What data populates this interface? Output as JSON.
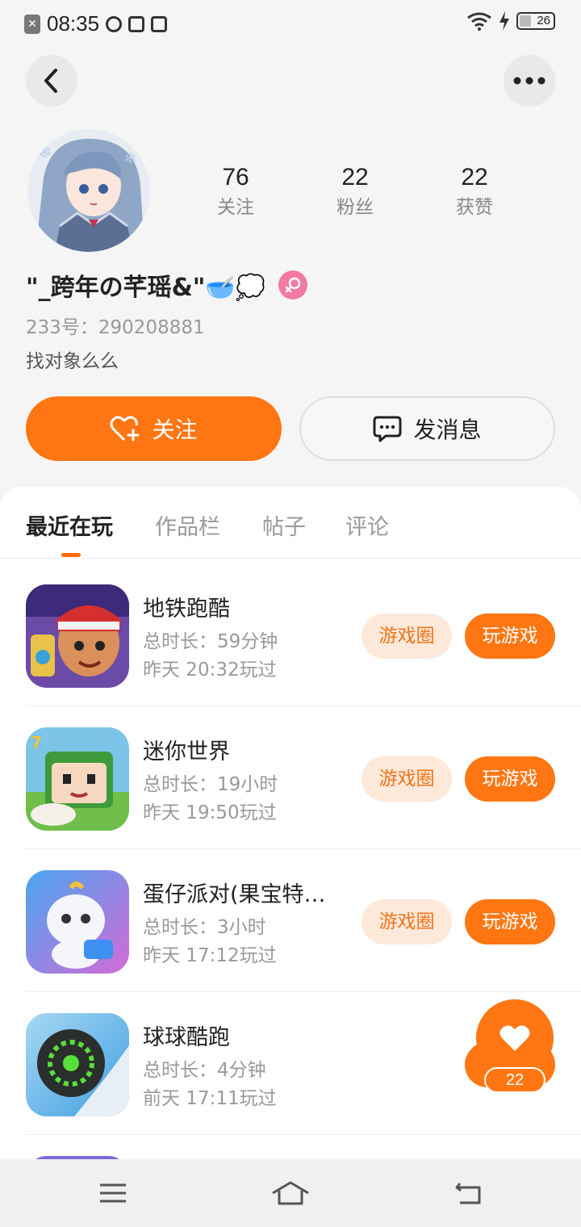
{
  "status_bar": {
    "time": "08:35",
    "battery": "26"
  },
  "header": {
    "back_icon": "chevron-left-icon",
    "more_icon": "more-dots-icon"
  },
  "profile": {
    "stats": [
      {
        "value": "76",
        "label": "关注"
      },
      {
        "value": "22",
        "label": "粉丝"
      },
      {
        "value": "22",
        "label": "获赞"
      }
    ],
    "username": "\"_跨年の芊瑶&\"🥣💭",
    "gender_icon": "female-icon",
    "uid_label": "233号：",
    "uid_value": "290208881",
    "bio": "找对象么么",
    "follow_label": "关注",
    "message_label": "发消息"
  },
  "tabs": [
    {
      "label": "最近在玩",
      "active": true
    },
    {
      "label": "作品栏",
      "active": false
    },
    {
      "label": "帖子",
      "active": false
    },
    {
      "label": "评论",
      "active": false
    }
  ],
  "games": [
    {
      "name": "地铁跑酷",
      "duration": "总时长：59分钟",
      "last_played": "昨天 20:32玩过",
      "circle_label": "游戏圈",
      "play_label": "玩游戏"
    },
    {
      "name": "迷你世界",
      "duration": "总时长：19小时",
      "last_played": "昨天 19:50玩过",
      "circle_label": "游戏圈",
      "play_label": "玩游戏"
    },
    {
      "name": "蛋仔派对(果宝特…",
      "duration": "总时长：3小时",
      "last_played": "昨天 17:12玩过",
      "circle_label": "游戏圈",
      "play_label": "玩游戏"
    },
    {
      "name": "球球酷跑",
      "duration": "总时长：4分钟",
      "last_played": "前天 17:11玩过",
      "circle_label": "",
      "play_label": ""
    }
  ],
  "like_float": {
    "count": "22",
    "icon": "heart-icon"
  },
  "nav": {
    "menu_icon": "menu-icon",
    "home_icon": "home-icon",
    "back_icon": "back-icon"
  },
  "colors": {
    "accent": "#ff7612",
    "accent_light": "#fde9da",
    "female": "#f27aa3"
  }
}
